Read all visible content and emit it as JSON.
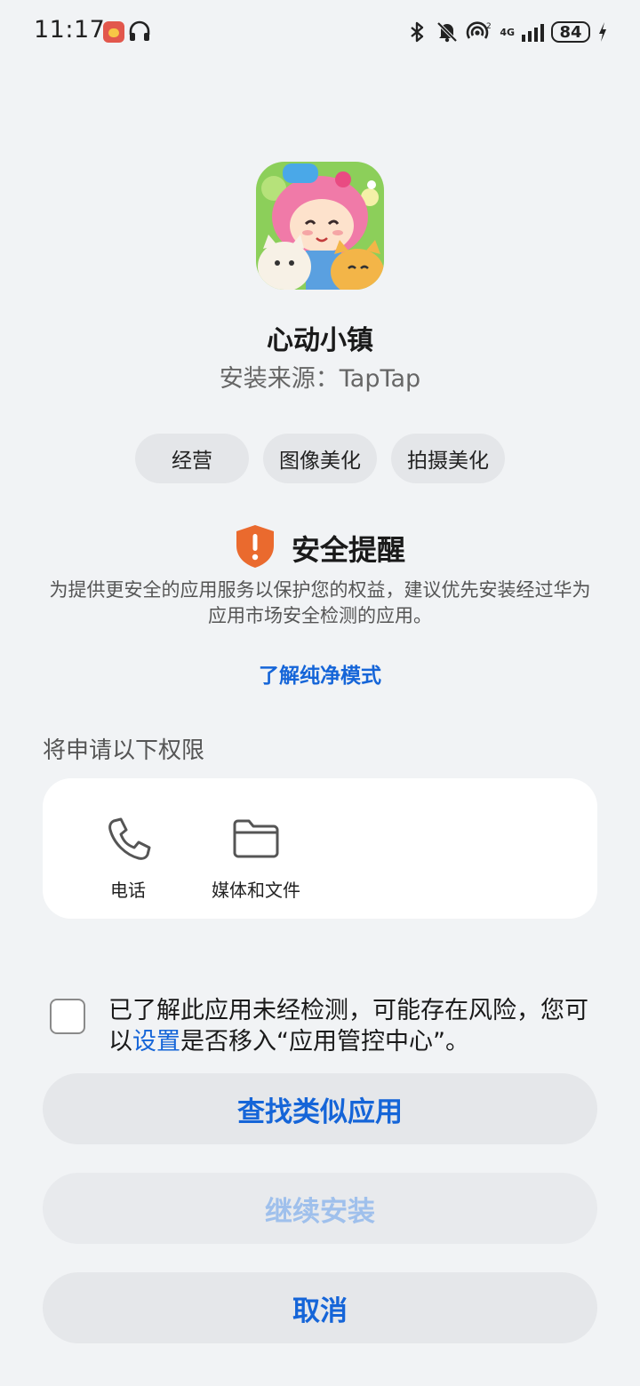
{
  "status_bar": {
    "time": "11:17",
    "signal_type": "4G",
    "wifi_index": "2",
    "battery": "84",
    "icons": [
      "app-notification-icon",
      "headset-icon",
      "bluetooth-icon",
      "mute-bell-icon",
      "hotspot-icon",
      "cellular-signal-icon",
      "battery-icon",
      "charging-bolt-icon"
    ]
  },
  "app": {
    "name": "心动小镇",
    "source": "安装来源：TapTap"
  },
  "tags": [
    "经营",
    "图像美化",
    "拍摄美化"
  ],
  "security": {
    "title": "安全提醒",
    "description": "为提供更安全的应用服务以保护您的权益，建议优先安装经过华为应用市场安全检测的应用。",
    "link": "了解纯净模式"
  },
  "permissions": {
    "label": "将申请以下权限",
    "items": [
      {
        "label": "电话",
        "icon": "phone-icon"
      },
      {
        "label": "媒体和文件",
        "icon": "folder-icon"
      }
    ]
  },
  "consent": {
    "text_before": "已了解此应用未经检测，可能存在风险，您可以",
    "link": "设置",
    "text_after": "是否移入“应用管控中心”。"
  },
  "buttons": {
    "find_similar": "查找类似应用",
    "continue_install": "继续安装",
    "cancel": "取消"
  },
  "colors": {
    "accent": "#1565d8",
    "warning": "#ea6a2e",
    "background": "#f1f3f5"
  }
}
